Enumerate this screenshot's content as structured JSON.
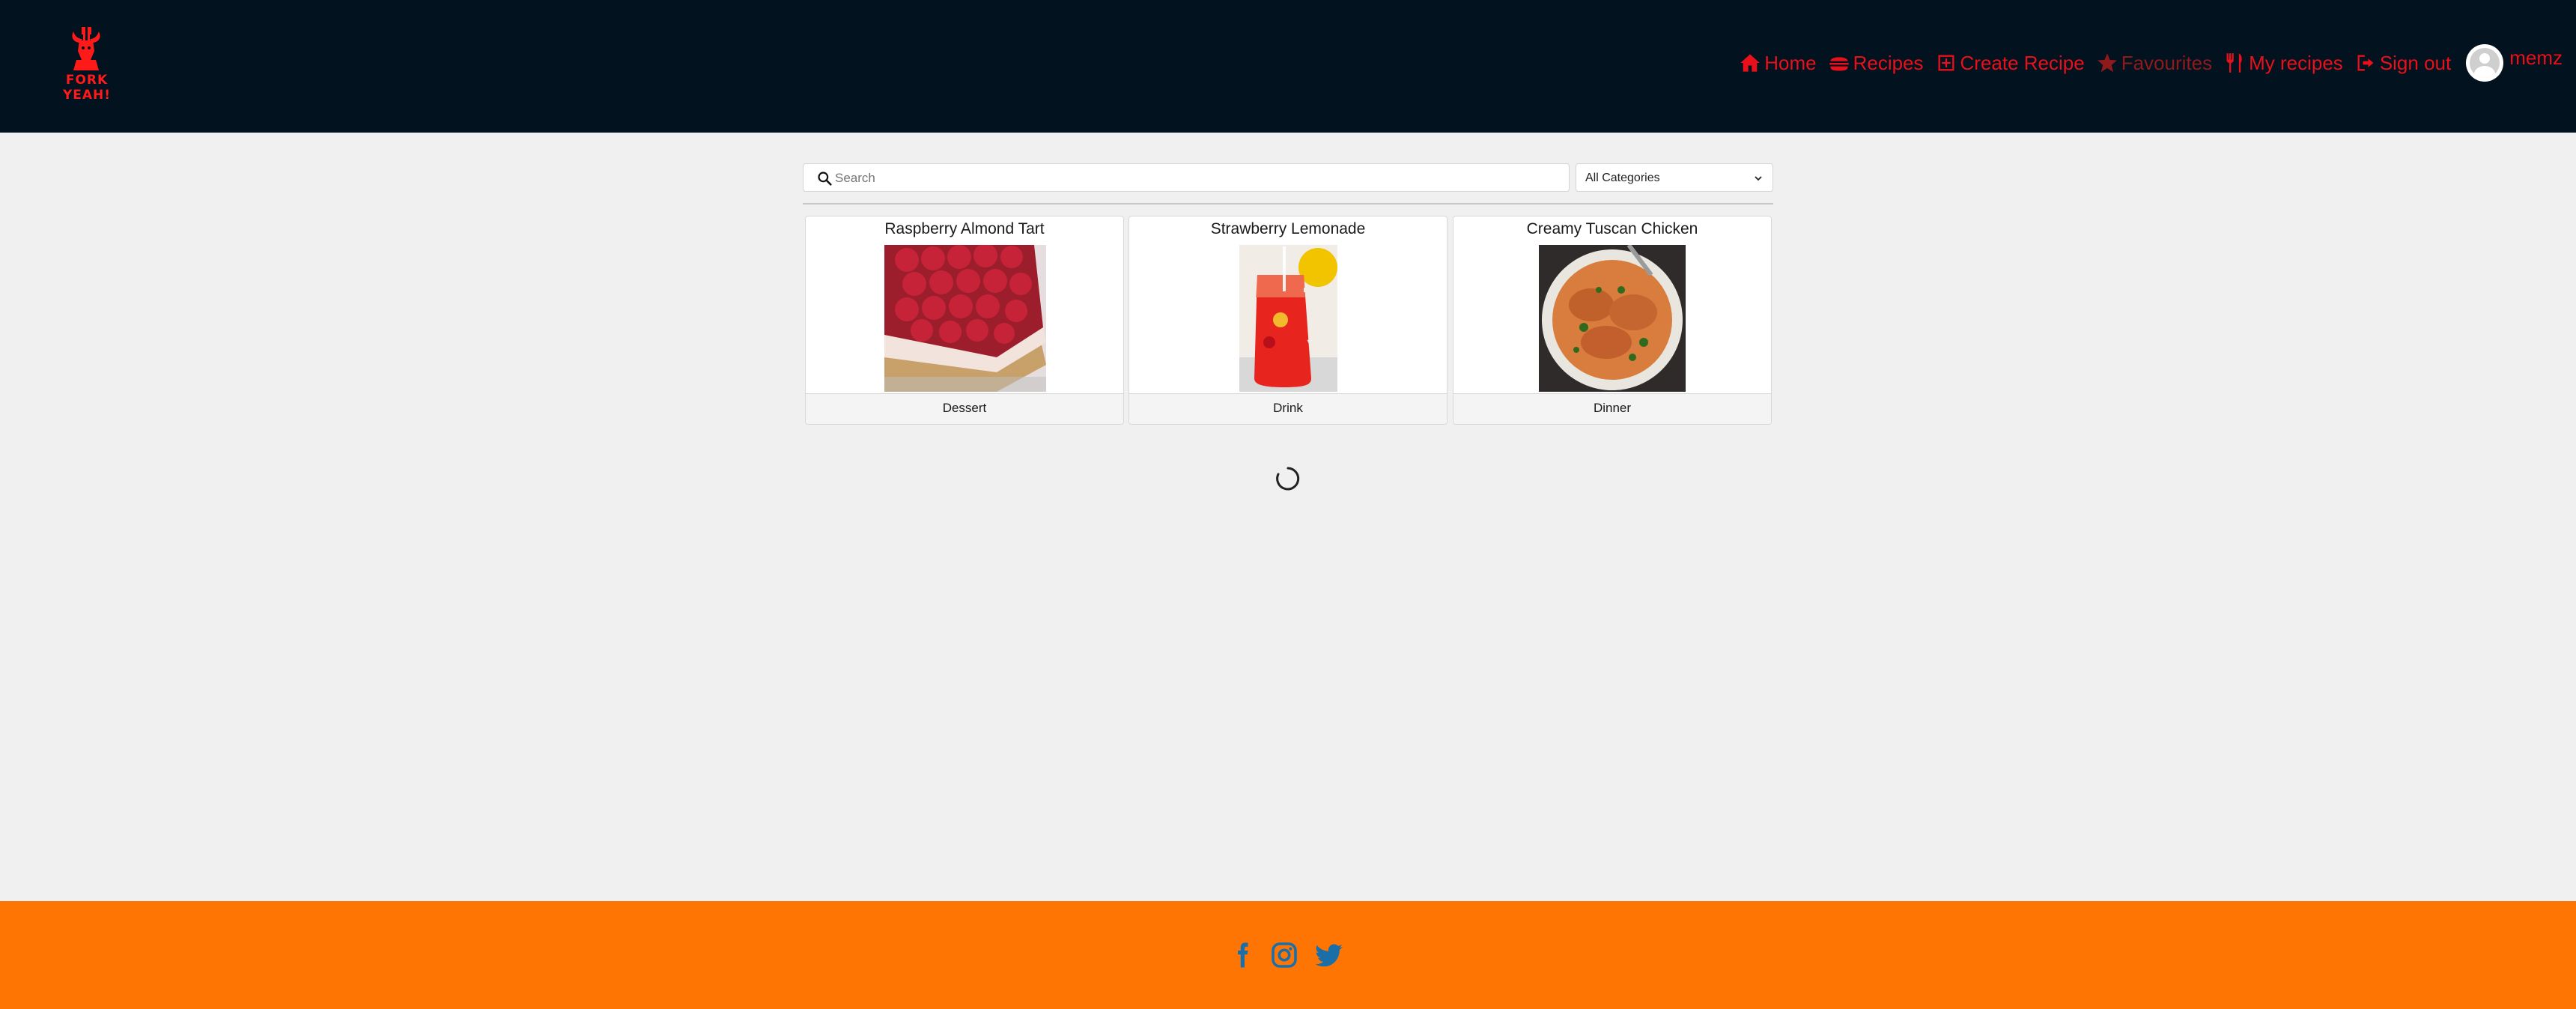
{
  "brand": {
    "logo_text": "FORK YEAH!"
  },
  "nav": {
    "items": [
      {
        "label": "Home",
        "icon": "home-icon"
      },
      {
        "label": "Recipes",
        "icon": "burger-icon"
      },
      {
        "label": "Create Recipe",
        "icon": "plus-square-icon"
      },
      {
        "label": "Favourites",
        "icon": "star-icon",
        "disabled": true
      },
      {
        "label": "My recipes",
        "icon": "utensils-icon"
      },
      {
        "label": "Sign out",
        "icon": "sign-out-icon"
      }
    ],
    "user": {
      "name": "memz",
      "icon": "avatar-icon"
    }
  },
  "search": {
    "placeholder": "Search",
    "value": ""
  },
  "category_filter": {
    "selected": "All Categories"
  },
  "recipes": [
    {
      "title": "Raspberry Almond Tart",
      "category": "Dessert"
    },
    {
      "title": "Strawberry Lemonade",
      "category": "Drink"
    },
    {
      "title": "Creamy Tuscan Chicken",
      "category": "Dinner"
    }
  ],
  "status": {
    "loading_icon": "spinner-icon"
  },
  "footer": {
    "social": [
      "facebook-icon",
      "instagram-icon",
      "twitter-icon"
    ]
  },
  "colors": {
    "header_bg": "#02121e",
    "accent": "#e8101a",
    "footer_bg": "#ff7504",
    "social_icon": "#1a6fa8",
    "page_bg": "#f0f0f0"
  }
}
